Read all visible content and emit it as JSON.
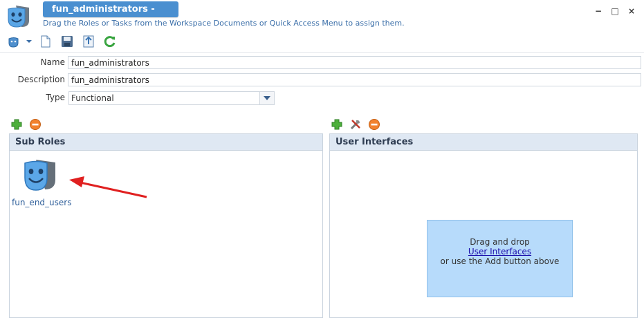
{
  "header": {
    "title": "fun_administrators - Role",
    "hint": "Drag the Roles or Tasks from the Workspace Documents or Quick Access Menu to assign them.",
    "window_controls": {
      "minimize": "−",
      "maximize": "□",
      "close": "×"
    }
  },
  "toolbar": {
    "icons": [
      "role-menu-icon",
      "new-document-icon",
      "save-icon",
      "export-icon",
      "refresh-icon"
    ]
  },
  "form": {
    "name_label": "Name",
    "name_value": "fun_administrators",
    "description_label": "Description",
    "description_value": "fun_administrators",
    "type_label": "Type",
    "type_value": "Functional"
  },
  "sub_roles": {
    "title": "Sub Roles",
    "items": [
      {
        "label": "fun_end_users"
      }
    ]
  },
  "user_interfaces": {
    "title": "User Interfaces",
    "drop_line1": "Drag and drop",
    "drop_link": "User Interfaces",
    "drop_line3": "or use the Add button above"
  },
  "colors": {
    "title_bar": "#4a8fd0",
    "panel_header": "#dfe8f3",
    "drop_zone": "#b7dbfb",
    "annotation_arrow": "#e02020"
  }
}
